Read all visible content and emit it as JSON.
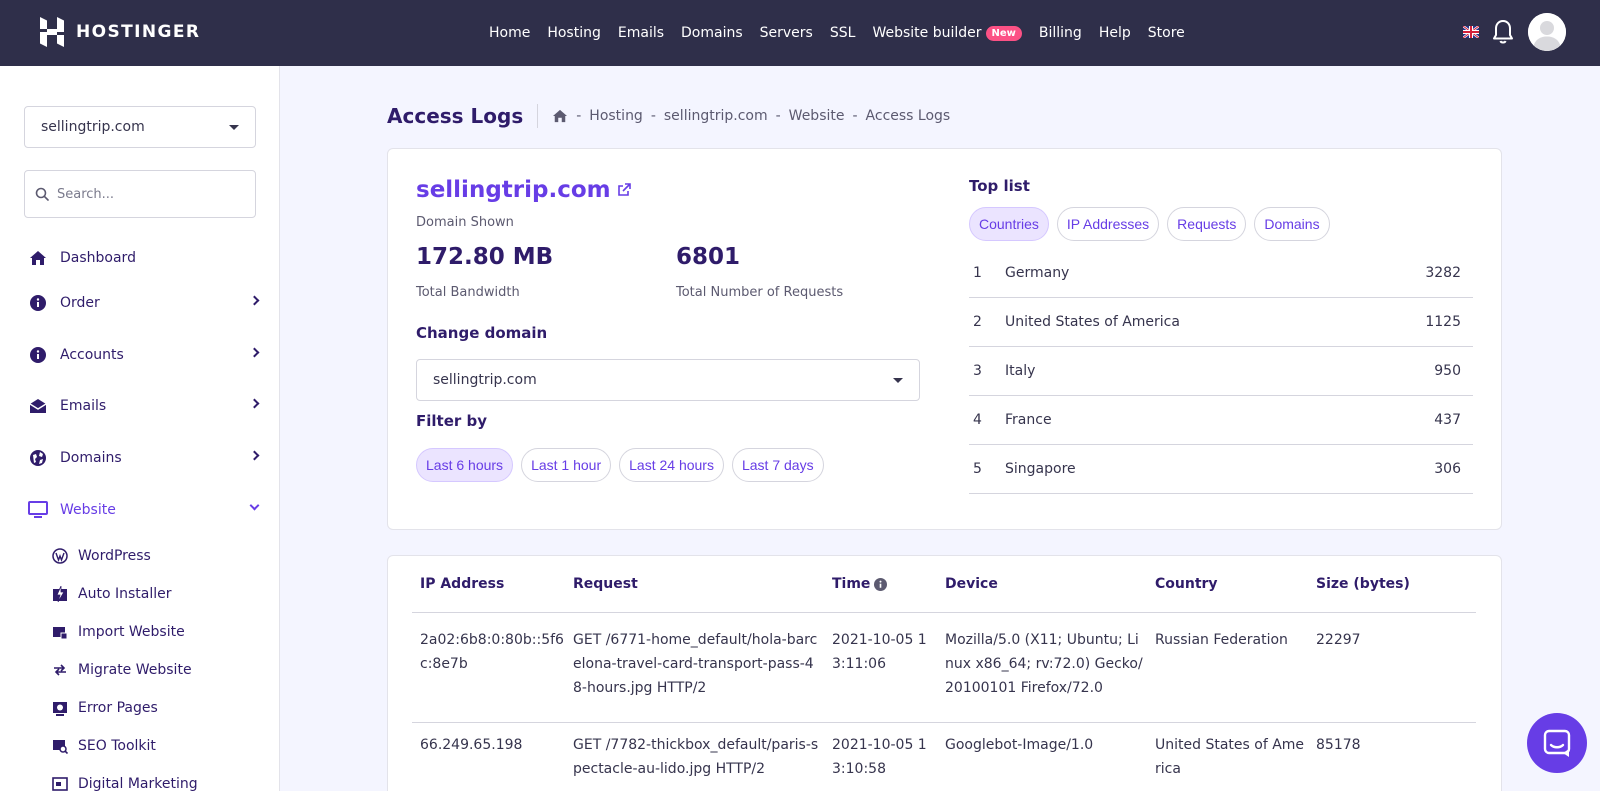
{
  "brand": {
    "name": "HOSTINGER"
  },
  "topnav": {
    "items": [
      "Home",
      "Hosting",
      "Emails",
      "Domains",
      "Servers",
      "SSL",
      "Website builder",
      "Billing",
      "Help",
      "Store"
    ],
    "new_badge": "New"
  },
  "sidebar": {
    "selected_domain": "sellingtrip.com",
    "search_placeholder": "Search...",
    "items": [
      {
        "label": "Dashboard",
        "icon": "home-icon"
      },
      {
        "label": "Order",
        "icon": "info-icon"
      },
      {
        "label": "Accounts",
        "icon": "info-icon"
      },
      {
        "label": "Emails",
        "icon": "envelope-icon"
      },
      {
        "label": "Domains",
        "icon": "globe-icon"
      },
      {
        "label": "Website",
        "icon": "monitor-icon"
      }
    ],
    "sub_items": [
      {
        "label": "WordPress",
        "icon": "wordpress-icon"
      },
      {
        "label": "Auto Installer",
        "icon": "installer-icon"
      },
      {
        "label": "Import Website",
        "icon": "import-icon"
      },
      {
        "label": "Migrate Website",
        "icon": "migrate-icon"
      },
      {
        "label": "Error Pages",
        "icon": "error-page-icon"
      },
      {
        "label": "SEO Toolkit",
        "icon": "seo-icon"
      },
      {
        "label": "Digital Marketing",
        "icon": "marketing-icon"
      }
    ]
  },
  "header": {
    "title": "Access Logs",
    "breadcrumb": [
      "Hosting",
      "sellingtrip.com",
      "Website",
      "Access Logs"
    ],
    "separator": "-"
  },
  "summary": {
    "domain": "sellingtrip.com",
    "domain_caption": "Domain Shown",
    "bandwidth_value": "172.80 MB",
    "bandwidth_label": "Total Bandwidth",
    "requests_value": "6801",
    "requests_label": "Total Number of Requests",
    "change_domain_label": "Change domain",
    "change_domain_value": "sellingtrip.com",
    "filter_label": "Filter by",
    "filters": [
      "Last 6 hours",
      "Last 1 hour",
      "Last 24 hours",
      "Last 7 days"
    ]
  },
  "top_list": {
    "title": "Top list",
    "tabs": [
      "Countries",
      "IP Addresses",
      "Requests",
      "Domains"
    ],
    "rows": [
      {
        "rank": "1",
        "name": "Germany",
        "value": "3282"
      },
      {
        "rank": "2",
        "name": "United States of America",
        "value": "1125"
      },
      {
        "rank": "3",
        "name": "Italy",
        "value": "950"
      },
      {
        "rank": "4",
        "name": "France",
        "value": "437"
      },
      {
        "rank": "5",
        "name": "Singapore",
        "value": "306"
      }
    ]
  },
  "table": {
    "headers": [
      "IP Address",
      "Request",
      "Time",
      "Device",
      "Country",
      "Size (bytes)"
    ],
    "rows": [
      {
        "ip": "2a02:6b8:0:80b::5f6c:8e7b",
        "request": "GET /6771-home_default/hola-barcelona-travel-card-transport-pass-48-hours.jpg HTTP/2",
        "time": "2021-10-05 13:11:06",
        "device": "Mozilla/5.0 (X11; Ubuntu; Linux x86_64; rv:72.0) Gecko/20100101 Firefox/72.0",
        "country": "Russian Federation",
        "size": "22297"
      },
      {
        "ip": "66.249.65.198",
        "request": "GET /7782-thickbox_default/paris-spectacle-au-lido.jpg HTTP/2",
        "time": "2021-10-05 13:10:58",
        "device": "Googlebot-Image/1.0",
        "country": "United States of America",
        "size": "85178"
      }
    ]
  },
  "colors": {
    "accent": "#673de6",
    "topbar": "#2f2f4a",
    "badge": "#fc5185"
  }
}
